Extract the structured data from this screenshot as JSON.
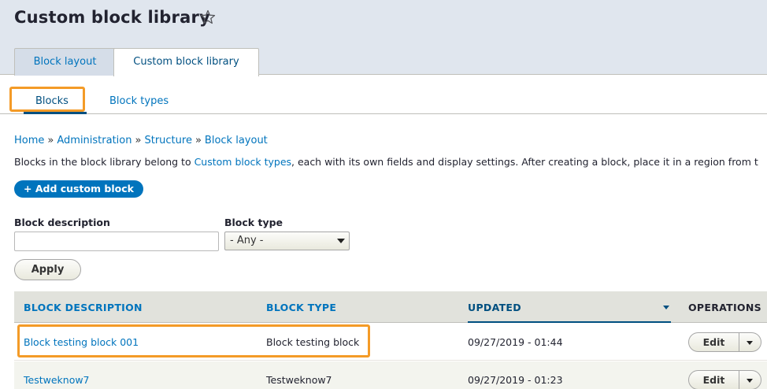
{
  "page": {
    "title": "Custom block library",
    "star_icon": "star-outline-icon"
  },
  "primary_tabs": [
    {
      "label": "Block layout",
      "active": false
    },
    {
      "label": "Custom block library",
      "active": true
    }
  ],
  "secondary_tabs": [
    {
      "label": "Blocks",
      "active": true
    },
    {
      "label": "Block types",
      "active": false
    }
  ],
  "breadcrumb": {
    "items": [
      "Home",
      "Administration",
      "Structure",
      "Block layout"
    ],
    "separator": "»"
  },
  "description": {
    "before": "Blocks in the block library belong to ",
    "link": "Custom block types",
    "after": ", each with its own fields and display settings. After creating a block, place it in a region from t"
  },
  "add_button": {
    "label": "+ Add custom block"
  },
  "filters": {
    "description_label": "Block description",
    "description_value": "",
    "type_label": "Block type",
    "type_value": "- Any -",
    "apply_label": "Apply"
  },
  "table": {
    "headers": {
      "description": "BLOCK DESCRIPTION",
      "type": "BLOCK TYPE",
      "updated": "UPDATED",
      "operations": "OPERATIONS"
    },
    "rows": [
      {
        "description": "Block testing block 001",
        "type": "Block testing block",
        "updated": "09/27/2019 - 01:44",
        "edit_label": "Edit"
      },
      {
        "description": "Testweknow7",
        "type": "Testweknow7",
        "updated": "09/27/2019 - 01:23",
        "edit_label": "Edit"
      }
    ]
  },
  "colors": {
    "link": "#0074bd",
    "active": "#004f80",
    "highlight": "#f49b27",
    "header_bg": "#e0e6ee",
    "table_head_bg": "#e1e2dc"
  }
}
